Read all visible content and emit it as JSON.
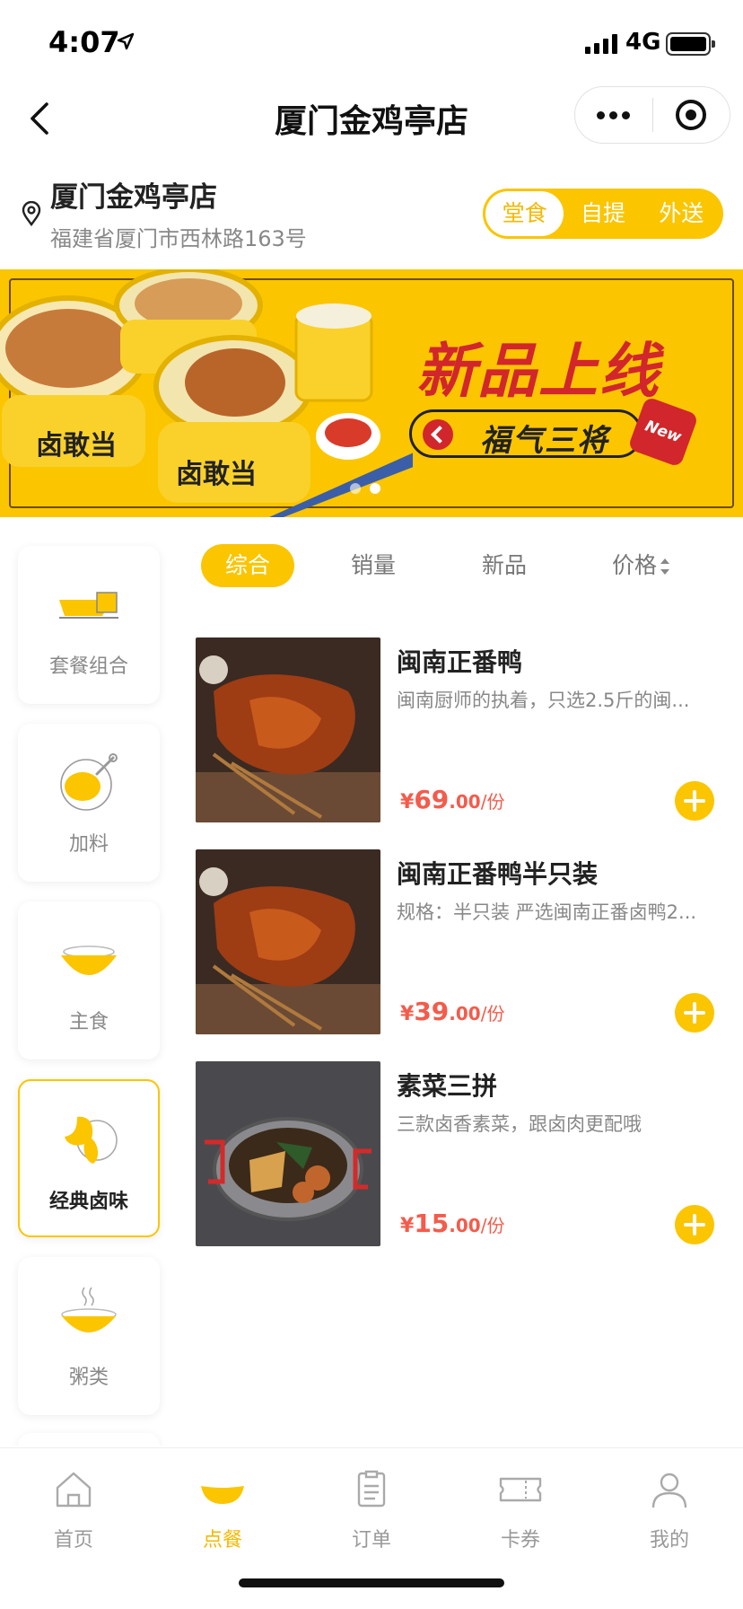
{
  "status_bar": {
    "time": "4:07",
    "network": "4G"
  },
  "nav": {
    "title": "厦门金鸡亭店"
  },
  "store": {
    "name": "厦门金鸡亭店",
    "address": "福建省厦门市西林路163号",
    "modes": [
      "堂食",
      "自提",
      "外送"
    ],
    "active_mode": "堂食"
  },
  "banner": {
    "headline": "新品上线",
    "subtitle": "福气三将",
    "badge": "New",
    "brand": "卤敢当"
  },
  "categories": [
    {
      "label": "套餐组合",
      "icon": "set-meal-icon"
    },
    {
      "label": "加料",
      "icon": "drumstick-icon"
    },
    {
      "label": "主食",
      "icon": "rice-bowl-icon"
    },
    {
      "label": "经典卤味",
      "icon": "braised-chicken-icon",
      "active": true
    },
    {
      "label": "粥类",
      "icon": "porridge-icon"
    }
  ],
  "sort_tabs": [
    "综合",
    "销量",
    "新品",
    "价格"
  ],
  "products": [
    {
      "name": "闽南正番鸭",
      "desc": "闽南厨师的执着，只选2.5斤的闽...",
      "currency": "¥",
      "price_int": "69",
      "price_dec": ".00",
      "unit": "/份"
    },
    {
      "name": "闽南正番鸭半只装",
      "desc": "规格：半只装 严选闽南正番卤鸭2...",
      "currency": "¥",
      "price_int": "39",
      "price_dec": ".00",
      "unit": "/份"
    },
    {
      "name": "素菜三拼",
      "desc": "三款卤香素菜，跟卤肉更配哦",
      "currency": "¥",
      "price_int": "15",
      "price_dec": ".00",
      "unit": "/份"
    }
  ],
  "tab_bar": [
    {
      "label": "首页",
      "icon": "home-icon"
    },
    {
      "label": "点餐",
      "icon": "order-food-icon",
      "active": true
    },
    {
      "label": "订单",
      "icon": "orders-icon"
    },
    {
      "label": "卡券",
      "icon": "coupon-icon"
    },
    {
      "label": "我的",
      "icon": "profile-icon"
    }
  ],
  "colors": {
    "accent": "#FBC500",
    "price": "#F45B4B",
    "banner_red": "#D1262B"
  }
}
